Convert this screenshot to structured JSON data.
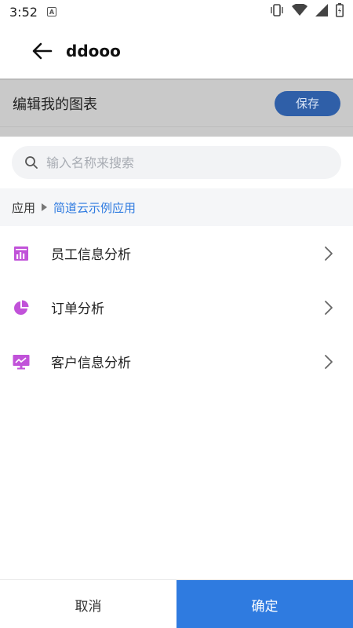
{
  "status_bar": {
    "time": "3:52",
    "icons": [
      "notification-a-icon",
      "vibrate-icon",
      "wifi-icon",
      "signal-icon",
      "battery-icon"
    ]
  },
  "app_bar": {
    "title": "ddooo",
    "back_icon": "arrow-left-icon"
  },
  "edit_bar": {
    "label": "编辑我的图表",
    "save_label": "保存",
    "save_color": "#2f5fa8"
  },
  "search": {
    "placeholder": "输入名称来搜索",
    "value": ""
  },
  "breadcrumb": {
    "root": "应用",
    "current": "简道云示例应用"
  },
  "items": [
    {
      "label": "员工信息分析",
      "icon": "bar-chart-icon",
      "color": "#c152d9"
    },
    {
      "label": "订单分析",
      "icon": "pie-chart-icon",
      "color": "#c152d9"
    },
    {
      "label": "客户信息分析",
      "icon": "monitor-chart-icon",
      "color": "#c152d9"
    }
  ],
  "footer": {
    "cancel_label": "取消",
    "confirm_label": "确定",
    "accent": "#2f7be0"
  }
}
